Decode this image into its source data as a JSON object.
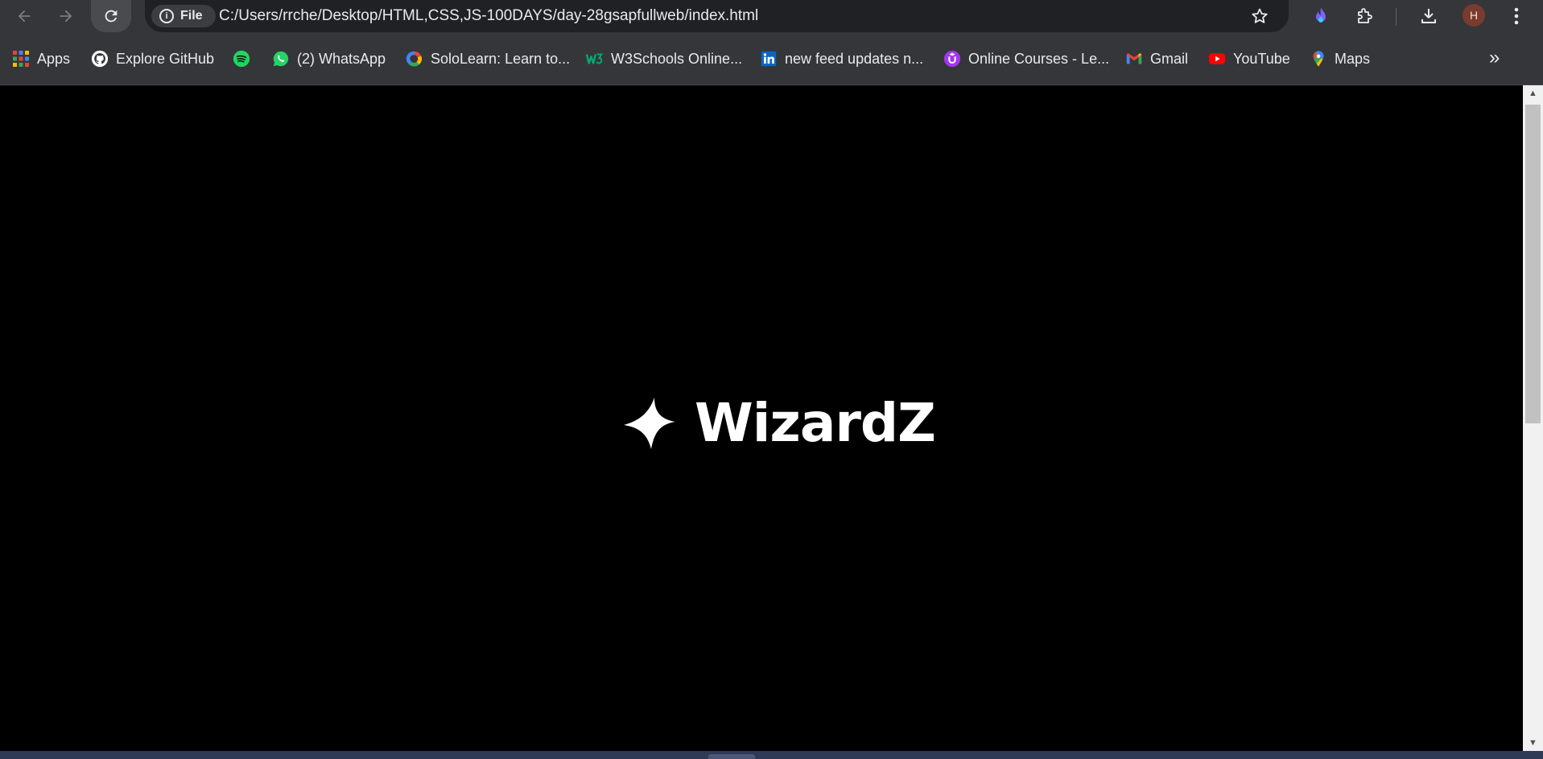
{
  "toolbar": {
    "back_icon": "arrow-left-icon",
    "forward_icon": "arrow-right-icon",
    "reload_icon": "reload-icon",
    "site_info_label": "File",
    "url": "C:/Users/rrche/Desktop/HTML,CSS,JS-100DAYS/day-28gsapfullweb/index.html",
    "avatar_letter": "H"
  },
  "bookmarks": [
    {
      "label": "Apps",
      "icon": "apps-grid-icon"
    },
    {
      "label": "Explore GitHub",
      "icon": "github-icon"
    },
    {
      "label": "",
      "icon": "spotify-icon"
    },
    {
      "label": "(2) WhatsApp",
      "icon": "whatsapp-icon"
    },
    {
      "label": "SoloLearn: Learn to...",
      "icon": "sololearn-icon"
    },
    {
      "label": "W3Schools Online...",
      "icon": "w3schools-icon"
    },
    {
      "label": "new feed updates n...",
      "icon": "linkedin-icon"
    },
    {
      "label": "Online Courses - Le...",
      "icon": "udemy-icon"
    },
    {
      "label": "Gmail",
      "icon": "gmail-icon"
    },
    {
      "label": "YouTube",
      "icon": "youtube-icon"
    },
    {
      "label": "Maps",
      "icon": "maps-icon"
    }
  ],
  "page": {
    "brand_name": "WizardZ",
    "brand_icon": "four-point-star-icon",
    "background": "#000000",
    "text_color": "#ffffff"
  }
}
